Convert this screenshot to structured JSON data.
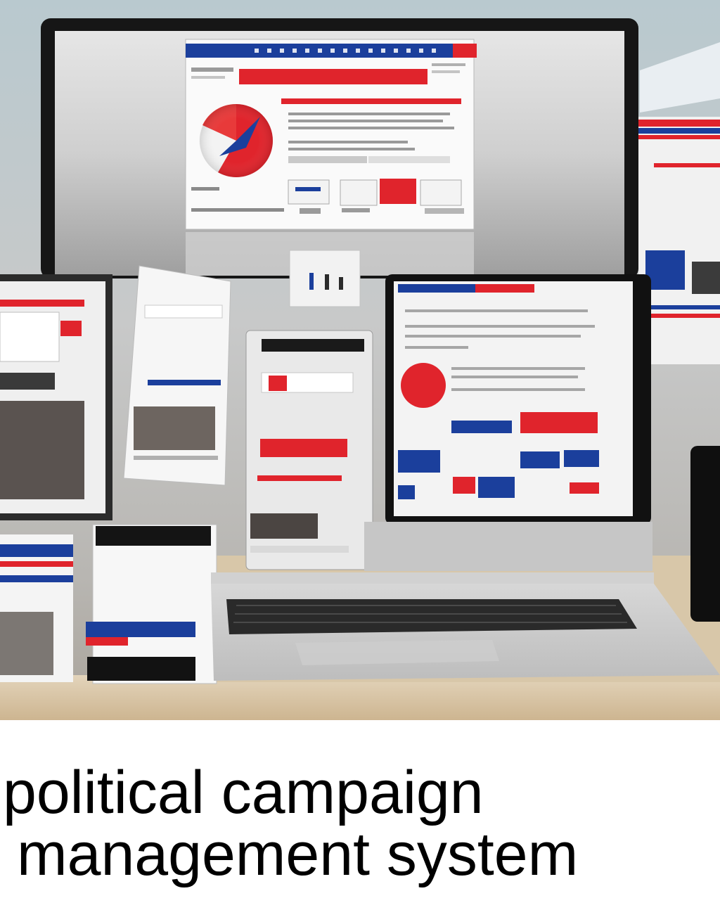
{
  "caption": {
    "line1": "political campaign",
    "line2": "management system"
  },
  "colors": {
    "red": "#e0242c",
    "blue": "#1b3f9c",
    "white": "#ffffff",
    "bezel": "#1a1a1a",
    "desk": "#d9c4a3",
    "wall": "#c9cdd0"
  }
}
